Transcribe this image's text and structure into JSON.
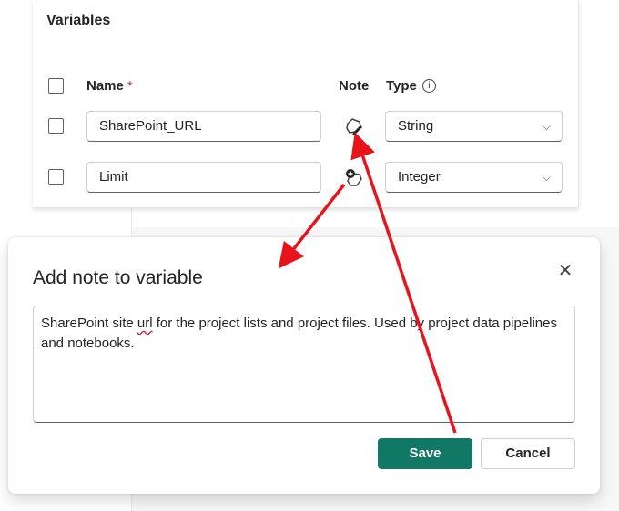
{
  "variables_panel": {
    "title": "Variables",
    "headers": {
      "name": "Name",
      "required_mark": "*",
      "note": "Note",
      "type": "Type",
      "info_icon": "i"
    },
    "rows": [
      {
        "name": "SharePoint_URL",
        "type": "String",
        "note_icon": "note-edit-icon"
      },
      {
        "name": "Limit",
        "type": "Integer",
        "note_icon": "note-add-icon"
      }
    ],
    "chevron": "⌵"
  },
  "dialog": {
    "title": "Add note to variable",
    "close_glyph": "✕",
    "note_text_before": "SharePoint site ",
    "note_text_misspelled": "url",
    "note_text_after": " for the project lists and project files. Used by project data pipelines and notebooks.",
    "save_label": "Save",
    "cancel_label": "Cancel"
  },
  "colors": {
    "primary": "#117865",
    "annotation_arrow": "#e8141c",
    "required": "#c4314b"
  }
}
